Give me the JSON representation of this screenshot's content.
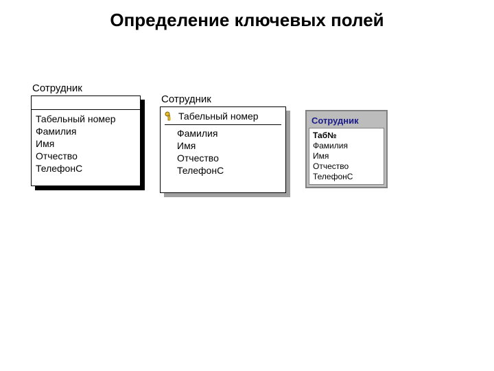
{
  "slide": {
    "title": "Определение ключевых полей"
  },
  "captions": {
    "p1": "Сотрудник",
    "p2": "Сотрудник",
    "p3": "Сотрудник"
  },
  "panel1": {
    "fields": {
      "f0": "Табельный номер",
      "f1": "Фамилия",
      "f2": "Имя",
      "f3": "Отчество",
      "f4": "ТелефонС"
    }
  },
  "panel2": {
    "key_field": "Табельный номер",
    "fields": {
      "f1": "Фамилия",
      "f2": "Имя",
      "f3": "Отчество",
      "f4": "ТелефонС"
    }
  },
  "panel3": {
    "pk": "Таб№",
    "fields": {
      "f1": "Фамилия",
      "f2": "Имя",
      "f3": "Отчество",
      "f4": "ТелефонС"
    }
  }
}
